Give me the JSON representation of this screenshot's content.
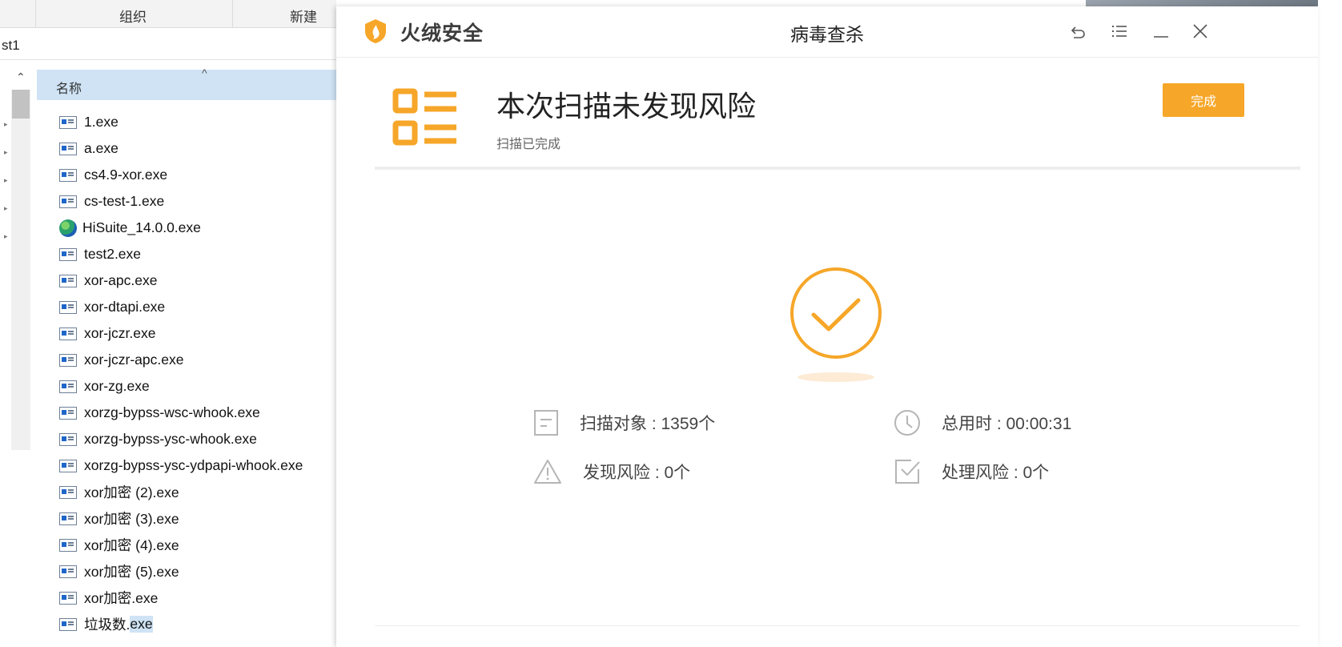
{
  "explorer": {
    "ribbon": {
      "tab_organize": "组织",
      "tab_new": "新建"
    },
    "address": "st1",
    "column_name": "名称",
    "files": [
      {
        "name": "1.exe",
        "icon": "exe-icon"
      },
      {
        "name": "a.exe",
        "icon": "exe-icon"
      },
      {
        "name": "cs4.9-xor.exe",
        "icon": "exe-icon"
      },
      {
        "name": "cs-test-1.exe",
        "icon": "exe-icon"
      },
      {
        "name": "HiSuite_14.0.0.exe",
        "icon": "globe-icon"
      },
      {
        "name": "test2.exe",
        "icon": "exe-icon"
      },
      {
        "name": "xor-apc.exe",
        "icon": "exe-icon"
      },
      {
        "name": "xor-dtapi.exe",
        "icon": "exe-icon"
      },
      {
        "name": "xor-jczr.exe",
        "icon": "exe-icon"
      },
      {
        "name": "xor-jczr-apc.exe",
        "icon": "exe-icon"
      },
      {
        "name": "xor-zg.exe",
        "icon": "exe-icon"
      },
      {
        "name": "xorzg-bypss-wsc-whook.exe",
        "icon": "exe-icon"
      },
      {
        "name": "xorzg-bypss-ysc-whook.exe",
        "icon": "exe-icon"
      },
      {
        "name": "xorzg-bypss-ysc-ydpapi-whook.exe",
        "icon": "exe-icon"
      },
      {
        "name": "xor加密 (2).exe",
        "icon": "exe-icon"
      },
      {
        "name": "xor加密 (3).exe",
        "icon": "exe-icon"
      },
      {
        "name": "xor加密 (4).exe",
        "icon": "exe-icon"
      },
      {
        "name": "xor加密 (5).exe",
        "icon": "exe-icon"
      },
      {
        "name": "xor加密.exe",
        "icon": "exe-icon"
      }
    ],
    "last_file": {
      "base": "垃圾数.",
      "ext": "exe"
    }
  },
  "huorong": {
    "brand": "火绒安全",
    "window_title": "病毒查杀",
    "result_title": "本次扫描未发现风险",
    "result_subtitle": "扫描已完成",
    "done_button": "完成",
    "stats": {
      "scanned": "扫描对象 : 1359个",
      "elapsed": "总用时 : 00:00:31",
      "risks_found": "发现风险 : 0个",
      "risks_handled": "处理风险 : 0个"
    },
    "colors": {
      "accent": "#f6a628",
      "icon_gray": "#b5b5b5"
    }
  }
}
